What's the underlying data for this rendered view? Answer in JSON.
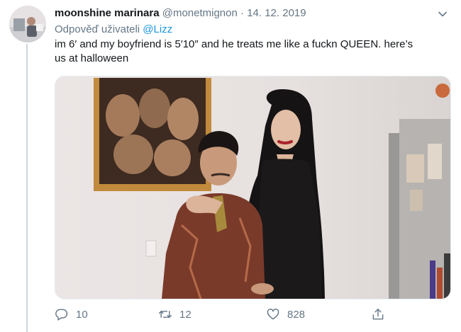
{
  "tweet": {
    "display_name": "moonshine marinara",
    "handle": "@monetmignon",
    "separator": "·",
    "date": "14. 12. 2019",
    "reply_prefix": "Odpověď uživateli",
    "reply_mention": "@Lizz",
    "text_line1": "im 6′ and my boyfriend is 5′10″ and he treats me like a fuckn QUEEN. here’s",
    "text_line2": "us at halloween"
  },
  "actions": {
    "replies": "10",
    "retweets": "12",
    "likes": "828"
  },
  "icons": [
    "chevron-down-icon",
    "reply-icon",
    "retweet-icon",
    "like-icon",
    "share-icon"
  ],
  "colors": {
    "text": "#14171a",
    "muted": "#657786",
    "link": "#1b95e0",
    "thread_line": "#ccd6dd"
  }
}
